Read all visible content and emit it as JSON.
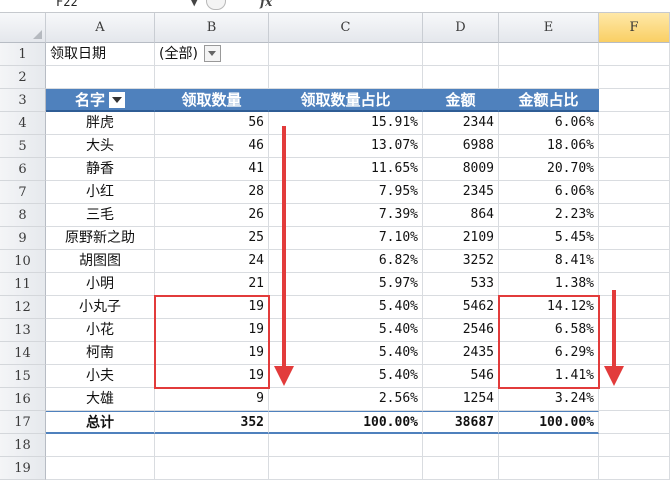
{
  "name_box": "F22",
  "formula_label": "fx",
  "columns": [
    "A",
    "B",
    "C",
    "D",
    "E",
    "F"
  ],
  "rows": [
    "1",
    "2",
    "3",
    "4",
    "5",
    "6",
    "7",
    "8",
    "9",
    "10",
    "11",
    "12",
    "13",
    "14",
    "15",
    "16",
    "17",
    "18",
    "19"
  ],
  "filter": {
    "label": "领取日期",
    "value": "(全部)"
  },
  "table_headers": [
    "名字",
    "领取数量",
    "领取数量占比",
    "金额",
    "金额占比"
  ],
  "table_rows": [
    {
      "name": "胖虎",
      "qty": "56",
      "qty_pct": "15.91%",
      "amount": "2344",
      "amount_pct": "6.06%"
    },
    {
      "name": "大头",
      "qty": "46",
      "qty_pct": "13.07%",
      "amount": "6988",
      "amount_pct": "18.06%"
    },
    {
      "name": "静香",
      "qty": "41",
      "qty_pct": "11.65%",
      "amount": "8009",
      "amount_pct": "20.70%"
    },
    {
      "name": "小红",
      "qty": "28",
      "qty_pct": "7.95%",
      "amount": "2345",
      "amount_pct": "6.06%"
    },
    {
      "name": "三毛",
      "qty": "26",
      "qty_pct": "7.39%",
      "amount": "864",
      "amount_pct": "2.23%"
    },
    {
      "name": "原野新之助",
      "qty": "25",
      "qty_pct": "7.10%",
      "amount": "2109",
      "amount_pct": "5.45%"
    },
    {
      "name": "胡图图",
      "qty": "24",
      "qty_pct": "6.82%",
      "amount": "3252",
      "amount_pct": "8.41%"
    },
    {
      "name": "小明",
      "qty": "21",
      "qty_pct": "5.97%",
      "amount": "533",
      "amount_pct": "1.38%"
    },
    {
      "name": "小丸子",
      "qty": "19",
      "qty_pct": "5.40%",
      "amount": "5462",
      "amount_pct": "14.12%"
    },
    {
      "name": "小花",
      "qty": "19",
      "qty_pct": "5.40%",
      "amount": "2546",
      "amount_pct": "6.58%"
    },
    {
      "name": "柯南",
      "qty": "19",
      "qty_pct": "5.40%",
      "amount": "2435",
      "amount_pct": "6.29%"
    },
    {
      "name": "小夫",
      "qty": "19",
      "qty_pct": "5.40%",
      "amount": "546",
      "amount_pct": "1.41%"
    },
    {
      "name": "大雄",
      "qty": "9",
      "qty_pct": "2.56%",
      "amount": "1254",
      "amount_pct": "3.24%"
    }
  ],
  "total": {
    "name": "总计",
    "qty": "352",
    "qty_pct": "100.00%",
    "amount": "38687",
    "amount_pct": "100.00%"
  },
  "colors": {
    "header_fill": "#4f81bd",
    "header_text": "#ffffff",
    "highlight": "#e23b3b",
    "active_column": "#f9cf64"
  }
}
